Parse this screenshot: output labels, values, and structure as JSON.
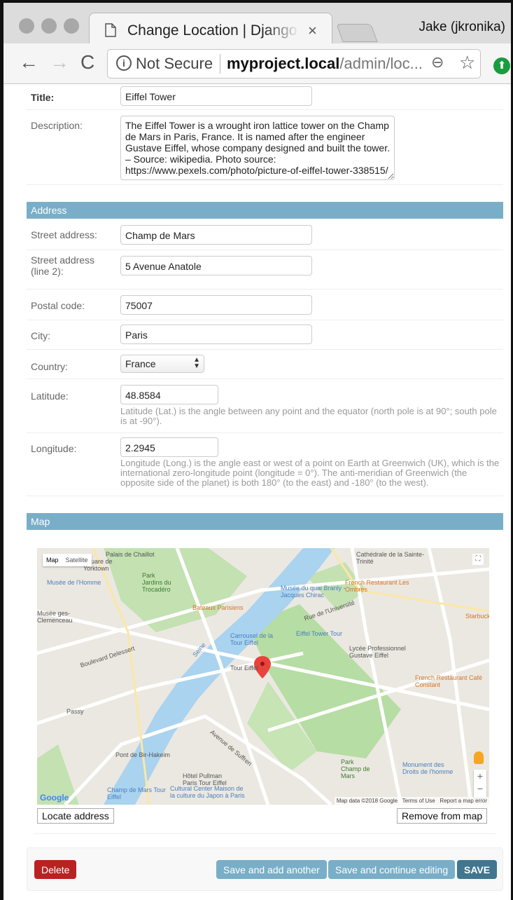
{
  "browser": {
    "tab_title": "Change Location | Django site admin",
    "tab_close": "×",
    "user": "Jake (jkronika)",
    "not_secure": "Not Secure",
    "url_host": "myproject.local",
    "url_path": "/admin/loc...",
    "icons": {
      "back": "←",
      "forward": "→",
      "reload": "C",
      "info": "i",
      "zoom": "⊖",
      "star": "☆",
      "update": "⬆"
    }
  },
  "form": {
    "title_label": "Title:",
    "title_value": "Eiffel Tower",
    "description_label": "Description:",
    "description_value": "The Eiffel Tower is a wrought iron lattice tower on the Champ de Mars in Paris, France. It is named after the engineer Gustave Eiffel, whose company designed and built the tower. – Source: wikipedia. Photo source: https://www.pexels.com/photo/picture-of-eiffel-tower-338515/",
    "address_header": "Address",
    "street_label": "Street address:",
    "street_value": "Champ de Mars",
    "street2_label": "Street address (line 2):",
    "street2_value": "5 Avenue Anatole",
    "postal_label": "Postal code:",
    "postal_value": "75007",
    "city_label": "City:",
    "city_value": "Paris",
    "country_label": "Country:",
    "country_value": "France",
    "latitude_label": "Latitude:",
    "latitude_value": "48.8584",
    "latitude_help": "Latitude (Lat.) is the angle between any point and the equator (north pole is at 90°; south pole is at -90°).",
    "longitude_label": "Longitude:",
    "longitude_value": "2.2945",
    "longitude_help": "Longitude (Long.) is the angle east or west of a point on Earth at Greenwich (UK), which is the international zero-longitude point (longitude = 0°). The anti-meridian of Greenwich (the opposite side of the planet) is both 180° (to the east) and -180° (to the west).",
    "map_header": "Map"
  },
  "map": {
    "type_map": "Map",
    "type_satellite": "Satellite",
    "google": "Google",
    "attribution": "Map data ©2018 Google   Terms of Use   Report a map error",
    "labels": [
      {
        "text": "Palais de Chaillot"
      },
      {
        "text": "Square de Yorktown"
      },
      {
        "text": "Musée de l'Homme"
      },
      {
        "text": "Park Jardins du Trocadéro"
      },
      {
        "text": "Cathédrale de la Sainte-Trinité"
      },
      {
        "text": "French Restaurant Les Ombres"
      },
      {
        "text": "Musée du quai Branly - Jacques Chirac"
      },
      {
        "text": "Bateaux Parisiens"
      },
      {
        "text": "Rue de l'Université"
      },
      {
        "text": "Eiffel Tower Tour"
      },
      {
        "text": "Carrousel de la Tour Eiffel"
      },
      {
        "text": "Tour Eiffel"
      },
      {
        "text": "Lycée Professionnel Gustave Eiffel"
      },
      {
        "text": "French Restaurant Café Constant"
      },
      {
        "text": "Seine"
      },
      {
        "text": "Passy"
      },
      {
        "text": "Boulevard Delessert"
      },
      {
        "text": "Pont de Bir-Hakeim"
      },
      {
        "text": "Hôtel Pullman Paris Tour Eiffel"
      },
      {
        "text": "Champ de Mars Tour Eiffel"
      },
      {
        "text": "Cultural Center Maison de la culture du Japon à Paris"
      },
      {
        "text": "Park Champ de Mars"
      },
      {
        "text": "Monument des Droits de l'homme"
      },
      {
        "text": "Starbucks"
      },
      {
        "text": "Avenue de Suffren"
      },
      {
        "text": "Musée ges-Clemenceau"
      }
    ]
  },
  "actions": {
    "locate": "Locate address",
    "remove": "Remove from map",
    "delete": "Delete",
    "save_add": "Save and add another",
    "save_continue": "Save and continue editing",
    "save": "SAVE"
  },
  "colors": {
    "module_header": "#79aec8",
    "delete": "#ba2121",
    "secondary": "#79aec8",
    "primary": "#417690"
  }
}
